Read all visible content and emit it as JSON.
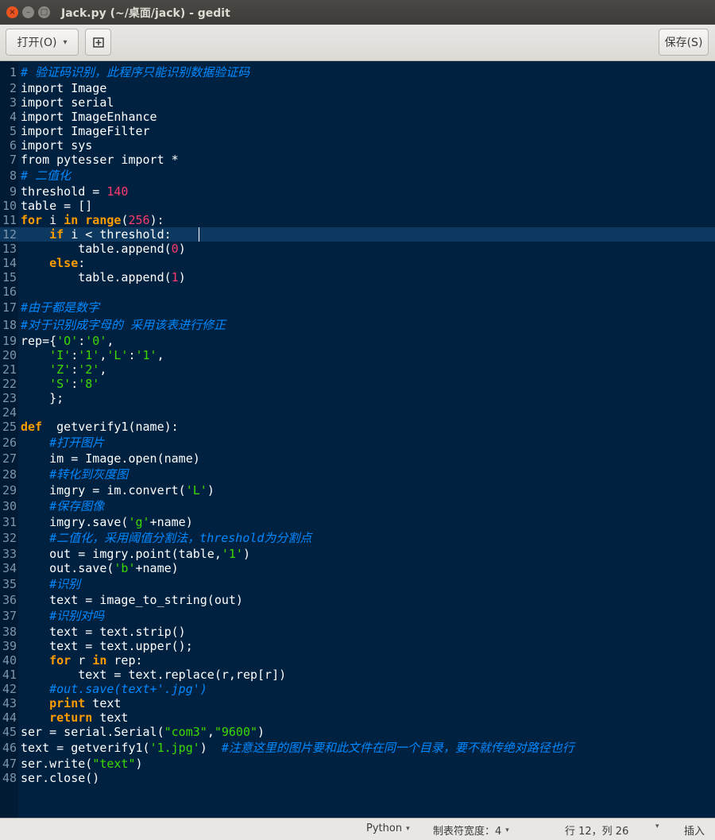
{
  "window": {
    "title": "Jack.py (~/桌面/jack) - gedit",
    "close_glyph": "×",
    "minimize_glyph": "–",
    "maximize_glyph": "□"
  },
  "toolbar": {
    "open_label": "打开(O)",
    "open_caret": "▾",
    "new_tab_glyph": "⊞",
    "save_label": "保存(S)"
  },
  "editor": {
    "current_line": 12,
    "lines": [
      [
        [
          "cm",
          "# 验证码识别，此程序只能识别数据验证码"
        ]
      ],
      [
        [
          "",
          "import Image"
        ]
      ],
      [
        [
          "",
          "import serial"
        ]
      ],
      [
        [
          "",
          "import ImageEnhance"
        ]
      ],
      [
        [
          "",
          "import ImageFilter"
        ]
      ],
      [
        [
          "",
          "import sys"
        ]
      ],
      [
        [
          "",
          "from pytesser import *"
        ]
      ],
      [
        [
          "cm",
          "# 二值化"
        ]
      ],
      [
        [
          "",
          "threshold = "
        ],
        [
          "num",
          "140"
        ]
      ],
      [
        [
          "",
          "table = []"
        ]
      ],
      [
        [
          "kw",
          "for"
        ],
        [
          "",
          " i "
        ],
        [
          "kw",
          "in"
        ],
        [
          "",
          " "
        ],
        [
          "kw",
          "range"
        ],
        [
          "",
          "("
        ],
        [
          "num",
          "256"
        ],
        [
          "",
          "):"
        ]
      ],
      [
        [
          "",
          "    "
        ],
        [
          "kw",
          "if"
        ],
        [
          "",
          " i < threshold:"
        ]
      ],
      [
        [
          "",
          "        table.append("
        ],
        [
          "num",
          "0"
        ],
        [
          "",
          ")"
        ]
      ],
      [
        [
          "",
          "    "
        ],
        [
          "kw",
          "else"
        ],
        [
          "",
          ":"
        ]
      ],
      [
        [
          "",
          "        table.append("
        ],
        [
          "num",
          "1"
        ],
        [
          "",
          ")"
        ]
      ],
      [
        [
          "",
          ""
        ]
      ],
      [
        [
          "cm",
          "#由于都是数字"
        ]
      ],
      [
        [
          "cm",
          "#对于识别成字母的 采用该表进行修正"
        ]
      ],
      [
        [
          "",
          "rep={"
        ],
        [
          "str",
          "'O'"
        ],
        [
          "",
          ":"
        ],
        [
          "str",
          "'0'"
        ],
        [
          "",
          ","
        ]
      ],
      [
        [
          "",
          "    "
        ],
        [
          "str",
          "'I'"
        ],
        [
          "",
          ":"
        ],
        [
          "str",
          "'1'"
        ],
        [
          "",
          ","
        ],
        [
          "str",
          "'L'"
        ],
        [
          "",
          ":"
        ],
        [
          "str",
          "'1'"
        ],
        [
          "",
          ","
        ]
      ],
      [
        [
          "",
          "    "
        ],
        [
          "str",
          "'Z'"
        ],
        [
          "",
          ":"
        ],
        [
          "str",
          "'2'"
        ],
        [
          "",
          ","
        ]
      ],
      [
        [
          "",
          "    "
        ],
        [
          "str",
          "'S'"
        ],
        [
          "",
          ":"
        ],
        [
          "str",
          "'8'"
        ]
      ],
      [
        [
          "",
          "    };"
        ]
      ],
      [
        [
          "",
          ""
        ]
      ],
      [
        [
          "kw",
          "def"
        ],
        [
          "",
          "  getverify1(name):"
        ]
      ],
      [
        [
          "",
          "    "
        ],
        [
          "cm",
          "#打开图片"
        ]
      ],
      [
        [
          "",
          "    im = Image.open(name)"
        ]
      ],
      [
        [
          "",
          "    "
        ],
        [
          "cm",
          "#转化到灰度图"
        ]
      ],
      [
        [
          "",
          "    imgry = im.convert("
        ],
        [
          "str",
          "'L'"
        ],
        [
          "",
          ")"
        ]
      ],
      [
        [
          "",
          "    "
        ],
        [
          "cm",
          "#保存图像"
        ]
      ],
      [
        [
          "",
          "    imgry.save("
        ],
        [
          "str",
          "'g'"
        ],
        [
          "",
          "+name)"
        ]
      ],
      [
        [
          "",
          "    "
        ],
        [
          "cm",
          "#二值化，采用阈值分割法，threshold为分割点"
        ]
      ],
      [
        [
          "",
          "    out = imgry.point(table,"
        ],
        [
          "str",
          "'1'"
        ],
        [
          "",
          ")"
        ]
      ],
      [
        [
          "",
          "    out.save("
        ],
        [
          "str",
          "'b'"
        ],
        [
          "",
          "+name)"
        ]
      ],
      [
        [
          "",
          "    "
        ],
        [
          "cm",
          "#识别"
        ]
      ],
      [
        [
          "",
          "    text = image_to_string(out)"
        ]
      ],
      [
        [
          "",
          "    "
        ],
        [
          "cm",
          "#识别对吗"
        ]
      ],
      [
        [
          "",
          "    text = text.strip()"
        ]
      ],
      [
        [
          "",
          "    text = text.upper();"
        ]
      ],
      [
        [
          "",
          "    "
        ],
        [
          "kw",
          "for"
        ],
        [
          "",
          " r "
        ],
        [
          "kw",
          "in"
        ],
        [
          "",
          " rep:"
        ]
      ],
      [
        [
          "",
          "        text = text.replace(r,rep[r])"
        ]
      ],
      [
        [
          "",
          "    "
        ],
        [
          "cm",
          "#out.save(text+'.jpg')"
        ]
      ],
      [
        [
          "",
          "    "
        ],
        [
          "kw",
          "print"
        ],
        [
          "",
          " text"
        ]
      ],
      [
        [
          "",
          "    "
        ],
        [
          "kw",
          "return"
        ],
        [
          "",
          " text"
        ]
      ],
      [
        [
          "",
          "ser = serial.Serial("
        ],
        [
          "str",
          "\"com3\""
        ],
        [
          "",
          ","
        ],
        [
          "str",
          "\"9600\""
        ],
        [
          "",
          ")"
        ]
      ],
      [
        [
          "",
          "text = getverify1("
        ],
        [
          "str",
          "'1.jpg'"
        ],
        [
          "",
          ")  "
        ],
        [
          "cm",
          "#注意这里的图片要和此文件在同一个目录，要不就传绝对路径也行"
        ]
      ],
      [
        [
          "",
          "ser.write("
        ],
        [
          "str",
          "\"text\""
        ],
        [
          "",
          ")"
        ]
      ],
      [
        [
          "",
          "ser.close()"
        ]
      ]
    ]
  },
  "statusbar": {
    "language": "Python",
    "tab_width": "制表符宽度：4",
    "position": "行 12，列 26",
    "mode": "插入",
    "caret": "▾"
  }
}
